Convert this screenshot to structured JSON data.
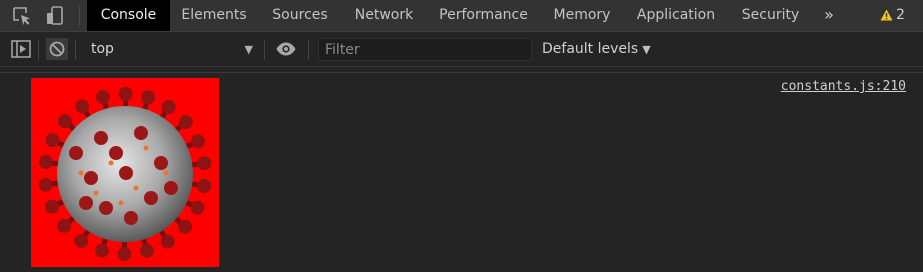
{
  "tabs": [
    {
      "label": "Console",
      "active": true
    },
    {
      "label": "Elements"
    },
    {
      "label": "Sources"
    },
    {
      "label": "Network"
    },
    {
      "label": "Performance"
    },
    {
      "label": "Memory"
    },
    {
      "label": "Application"
    },
    {
      "label": "Security"
    }
  ],
  "more_tabs_glyph": "»",
  "warnings": {
    "count": "2",
    "icon": "warning-triangle-icon",
    "color": "#f5c518"
  },
  "toolbar": {
    "context": "top",
    "filter_placeholder": "Filter",
    "filter_value": "",
    "levels": "Default levels"
  },
  "console": {
    "source": "constants.js:210",
    "image_description_icon": "virus-image",
    "image_background": "#ff0000"
  },
  "colors": {
    "active_tab": "#000000",
    "panel": "#242424",
    "tabbar": "#333333"
  }
}
